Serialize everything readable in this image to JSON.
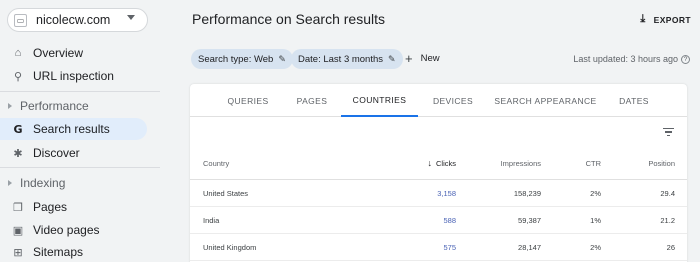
{
  "property": {
    "name": "nicolecw.com"
  },
  "nav": {
    "overview": "Overview",
    "url_inspection": "URL inspection",
    "performance_section": "Performance",
    "search_results": "Search results",
    "discover": "Discover",
    "indexing_section": "Indexing",
    "pages": "Pages",
    "video_pages": "Video pages",
    "sitemaps": "Sitemaps"
  },
  "header": {
    "title": "Performance on Search results",
    "export_label": "EXPORT"
  },
  "filters": {
    "search_type": "Search type: Web",
    "date": "Date: Last 3 months",
    "new_label": "New",
    "last_updated": "Last updated: 3 hours ago"
  },
  "tabs": [
    "QUERIES",
    "PAGES",
    "COUNTRIES",
    "DEVICES",
    "SEARCH APPEARANCE",
    "DATES"
  ],
  "active_tab": "COUNTRIES",
  "table": {
    "headers": {
      "country": "Country",
      "clicks": "Clicks",
      "impressions": "Impressions",
      "ctr": "CTR",
      "position": "Position"
    },
    "rows": [
      {
        "country": "United States",
        "clicks": "3,158",
        "impressions": "158,239",
        "ctr": "2%",
        "position": "29.4"
      },
      {
        "country": "India",
        "clicks": "588",
        "impressions": "59,387",
        "ctr": "1%",
        "position": "21.2"
      },
      {
        "country": "United Kingdom",
        "clicks": "575",
        "impressions": "28,147",
        "ctr": "2%",
        "position": "26"
      }
    ]
  },
  "colors": {
    "accent": "#1a73e8",
    "active_nav_bg": "#e1edfb",
    "chip_bg": "#d7e3f0",
    "page_bg": "#f1f3f4"
  },
  "icons": {
    "overview": "home-icon",
    "url_inspection": "search-icon",
    "search_results": "google-g-icon",
    "discover": "asterisk-icon",
    "pages": "pages-icon",
    "video_pages": "video-pages-icon",
    "sitemaps": "sitemap-icon",
    "export": "download-icon",
    "edit": "pencil-icon",
    "filter": "filter-icon"
  }
}
